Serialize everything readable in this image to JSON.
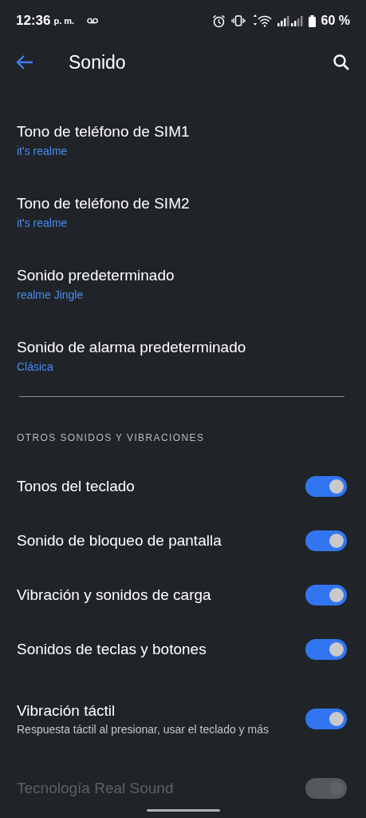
{
  "status_bar": {
    "time": "12:36",
    "ampm": "p. m.",
    "battery": "60 %"
  },
  "app_bar": {
    "title": "Sonido"
  },
  "ringtones": [
    {
      "title": "Tono de teléfono de SIM1",
      "value": "it's realme"
    },
    {
      "title": "Tono de teléfono de SIM2",
      "value": "it's realme"
    },
    {
      "title": "Sonido predeterminado",
      "value": "realme Jingle"
    },
    {
      "title": "Sonido de alarma predeterminado",
      "value": "Clásica"
    }
  ],
  "section_header": "OTROS SONIDOS Y VIBRACIONES",
  "toggles": [
    {
      "title": "Tonos del teclado",
      "on": true,
      "disabled": false
    },
    {
      "title": "Sonido de bloqueo de pantalla",
      "on": true,
      "disabled": false
    },
    {
      "title": "Vibración y sonidos de carga",
      "on": true,
      "disabled": false
    },
    {
      "title": "Sonidos de teclas y botones",
      "on": true,
      "disabled": false
    },
    {
      "title": "Vibración táctil",
      "subtitle": "Respuesta táctil al presionar, usar el teclado y más",
      "on": true,
      "disabled": false
    },
    {
      "title": "Tecnología Real Sound",
      "on": true,
      "disabled": true
    }
  ]
}
